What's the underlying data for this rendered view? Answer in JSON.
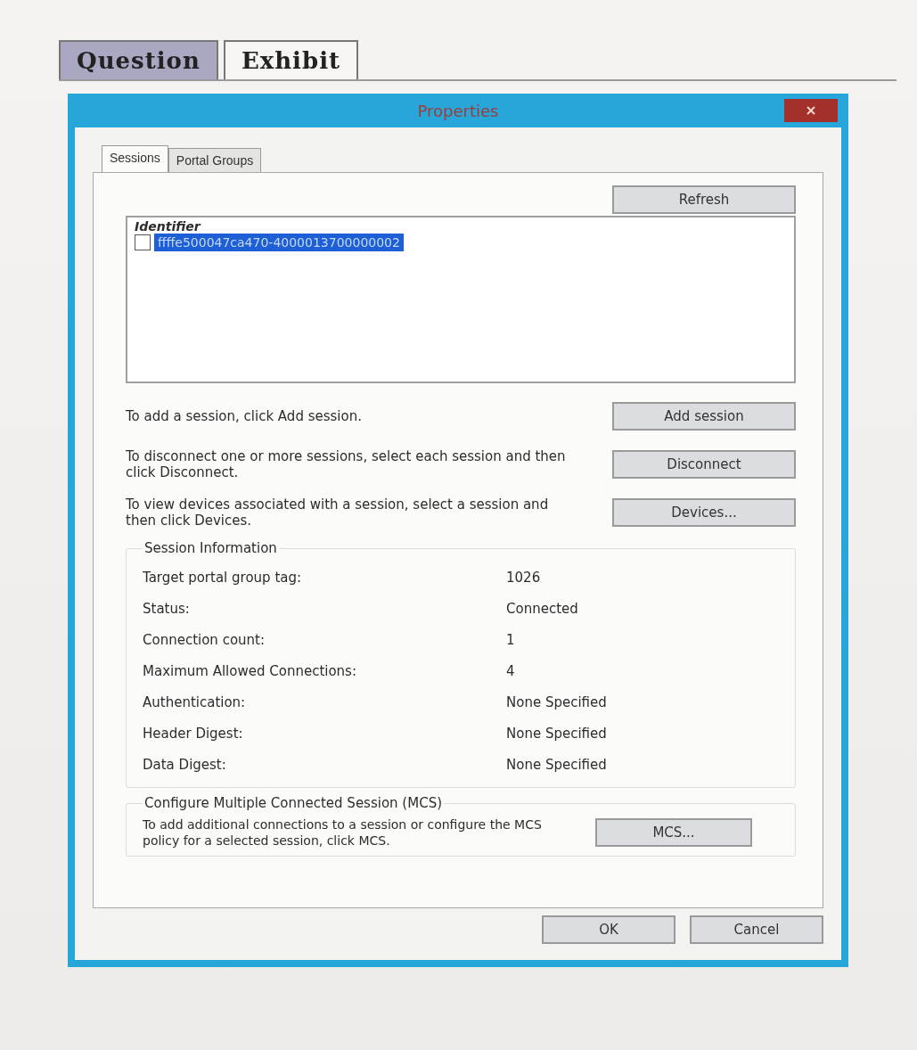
{
  "outer_tabs": [
    {
      "label": "Question",
      "selected": false
    },
    {
      "label": "Exhibit",
      "selected": true
    }
  ],
  "dialog": {
    "title": "Properties",
    "tabs": [
      {
        "label": "Sessions",
        "selected": true
      },
      {
        "label": "Portal Groups",
        "selected": false
      }
    ],
    "refresh_button": "Refresh",
    "sessions_list": {
      "column": "Identifier",
      "rows": [
        {
          "identifier": "ffffe500047ca470-4000013700000002",
          "checked": false,
          "selected": true
        }
      ]
    },
    "actions": [
      {
        "text": "To add a session, click Add session.",
        "button": "Add session"
      },
      {
        "text": "To disconnect one or more sessions, select each session and then click Disconnect.",
        "button": "Disconnect"
      },
      {
        "text": "To view devices associated with a session, select a session and then click Devices.",
        "button": "Devices..."
      }
    ],
    "session_information": {
      "title": "Session Information",
      "fields": [
        {
          "label": "Target portal group tag:",
          "value": "1026"
        },
        {
          "label": "Status:",
          "value": "Connected"
        },
        {
          "label": "Connection count:",
          "value": "1"
        },
        {
          "label": "Maximum Allowed Connections:",
          "value": "4"
        },
        {
          "label": "Authentication:",
          "value": "None Specified"
        },
        {
          "label": "Header Digest:",
          "value": "None Specified"
        },
        {
          "label": "Data Digest:",
          "value": "None Specified"
        }
      ]
    },
    "mcs": {
      "title": "Configure Multiple Connected Session (MCS)",
      "text": "To add additional connections to a session or configure the MCS policy for a selected session, click MCS.",
      "button": "MCS..."
    },
    "buttons": [
      "OK",
      "Cancel"
    ]
  }
}
